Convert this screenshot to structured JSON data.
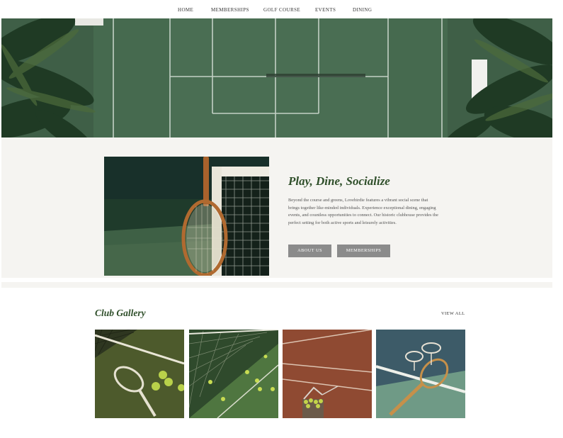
{
  "nav": {
    "items": [
      "HOME",
      "MEMBERSHIPS",
      "GOLF COURSE",
      "EVENTS",
      "DINING"
    ]
  },
  "hero": {
    "image": "aerial-tennis-court-with-palms"
  },
  "feature": {
    "image": "tennis-racket-leaning-on-net",
    "heading": "Play, Dine, Socialize",
    "paragraph": "Beyond the course and greens, Lovebirdie features a vibrant social scene that brings together like-minded individuals. Experience exceptional dining, engaging events, and countless opportunities to connect. Our historic clubhouse provides the perfect setting for both active sports and leisurely activities.",
    "buttons": [
      "ABOUT US",
      "MEMBERSHIPS"
    ]
  },
  "gallery": {
    "title": "Club Gallery",
    "view_all": "VIEW ALL",
    "images": [
      "racket-and-balls-on-court",
      "net-and-balls-on-grass",
      "ball-basket-on-clay-court",
      "racket-and-glasses"
    ]
  },
  "colors": {
    "accent_green": "#2f4f2a",
    "button_gray": "#8b8b8b",
    "section_bg": "#f5f4f1"
  }
}
